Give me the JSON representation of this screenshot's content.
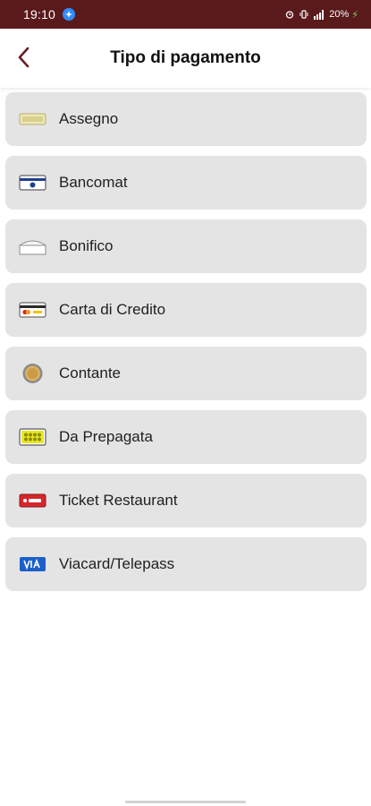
{
  "status_bar": {
    "time": "19:10",
    "battery": "20%",
    "background_color": "#5a1a1c"
  },
  "header": {
    "title": "Tipo di pagamento",
    "back_icon": "chevron-left-icon",
    "accent_color": "#6b1e22"
  },
  "payment_types": [
    {
      "label": "Assegno",
      "icon": "cheque-icon"
    },
    {
      "label": "Bancomat",
      "icon": "bancomat-card-icon"
    },
    {
      "label": "Bonifico",
      "icon": "bank-transfer-envelope-icon"
    },
    {
      "label": "Carta di Credito",
      "icon": "credit-card-icon"
    },
    {
      "label": "Contante",
      "icon": "coin-icon"
    },
    {
      "label": "Da Prepagata",
      "icon": "prepaid-card-icon"
    },
    {
      "label": "Ticket Restaurant",
      "icon": "meal-ticket-icon"
    },
    {
      "label": "Viacard/Telepass",
      "icon": "viacard-icon"
    }
  ]
}
